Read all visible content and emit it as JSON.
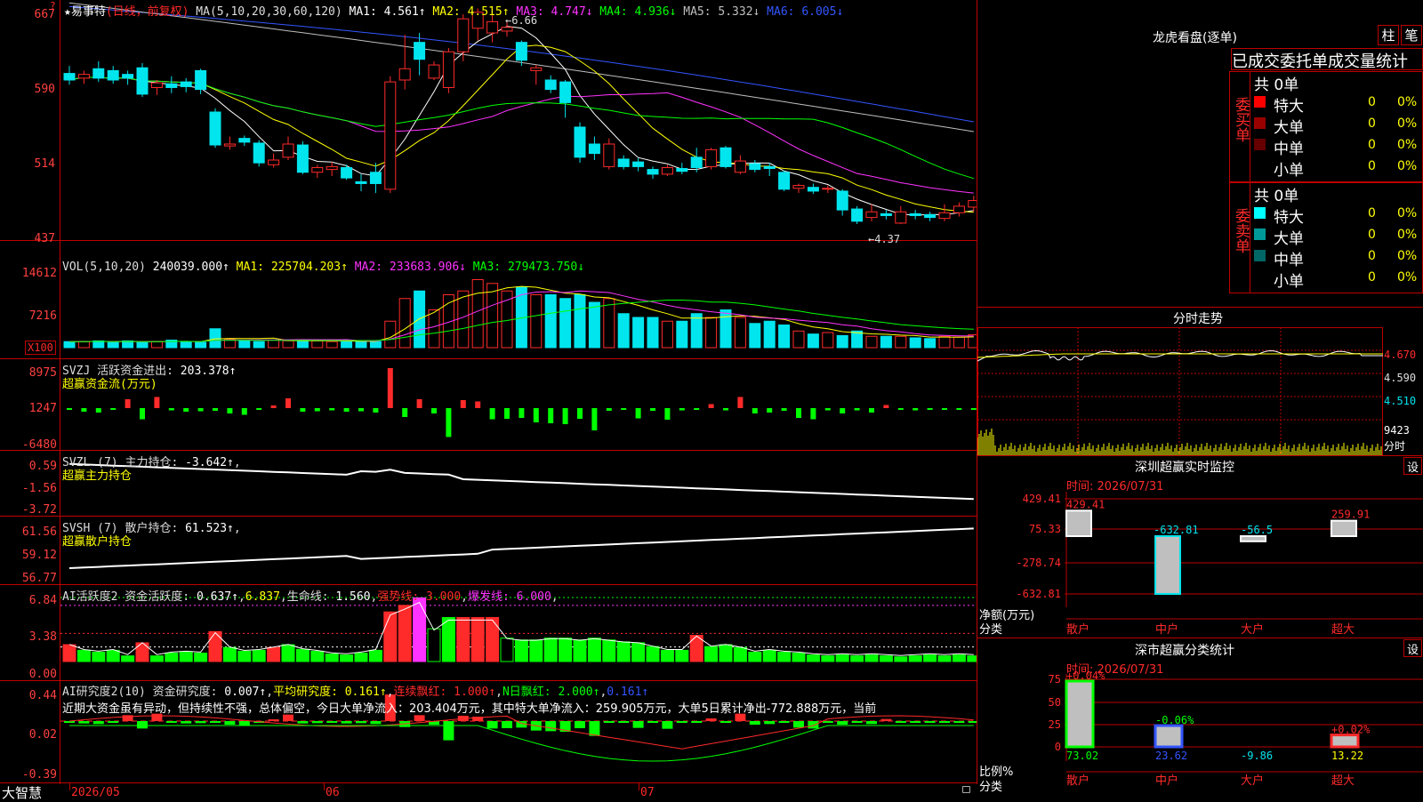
{
  "colors": {
    "up": "#ff2a2a",
    "down": "#00e5ee",
    "axis": "#c00000",
    "text": "#dddddd",
    "yellow": "#ffff00",
    "magenta": "#ff33ff",
    "green": "#00ff00",
    "blue": "#3355ff",
    "white": "#ffffff",
    "gray": "#bfbfbf"
  },
  "app": {
    "logo": "大智慧",
    "question_icon": "question-icon",
    "lock_icon": "lock-icon"
  },
  "main_chart": {
    "title_parts": [
      {
        "text": "★易事特",
        "color": "#ffffff"
      },
      {
        "text": "(日线，前复权)",
        "color": "#ff2a2a"
      },
      {
        "text": " MA(5,10,20,30,60,120) ",
        "color": "#dddddd"
      },
      {
        "text": "MA1: ",
        "color": "#ffffff"
      },
      {
        "text": "4.561↑",
        "color": "#ffffff"
      },
      {
        "text": " MA2: ",
        "color": "#ffff00"
      },
      {
        "text": "4.515↑",
        "color": "#ffff00"
      },
      {
        "text": " MA3: ",
        "color": "#ff33ff"
      },
      {
        "text": "4.747↓",
        "color": "#ff33ff"
      },
      {
        "text": " MA4: ",
        "color": "#00ff00"
      },
      {
        "text": "4.936↓",
        "color": "#00ff00"
      },
      {
        "text": " MA5: ",
        "color": "#bfbfbf"
      },
      {
        "text": "5.332↓",
        "color": "#bfbfbf"
      },
      {
        "text": " MA6: ",
        "color": "#3355ff"
      },
      {
        "text": "6.005↓",
        "color": "#3355ff"
      }
    ],
    "y_ticks": [
      "667",
      "590",
      "514",
      "437"
    ],
    "high_label": "6.66",
    "low_label": "4.37"
  },
  "vol_chart": {
    "title_parts": [
      {
        "text": "VOL(5,10,20) ",
        "color": "#dddddd"
      },
      {
        "text": "240039.000↑",
        "color": "#ffffff"
      },
      {
        "text": " MA1: ",
        "color": "#ffff00"
      },
      {
        "text": "225704.203↑",
        "color": "#ffff00"
      },
      {
        "text": " MA2: ",
        "color": "#ff33ff"
      },
      {
        "text": "233683.906↓",
        "color": "#ff33ff"
      },
      {
        "text": " MA3: ",
        "color": "#00ff00"
      },
      {
        "text": "279473.750↓",
        "color": "#00ff00"
      }
    ],
    "y_ticks": [
      "14612",
      "7216"
    ],
    "unit": "X100"
  },
  "svzj": {
    "title_parts": [
      {
        "text": "SVZJ  活跃资金进出: ",
        "color": "#dddddd"
      },
      {
        "text": "203.378↑",
        "color": "#ffffff"
      }
    ],
    "subtitle": "超赢资金流(万元)",
    "y_ticks": [
      "8975",
      "1247",
      "-6480"
    ]
  },
  "svzl": {
    "title_parts": [
      {
        "text": "SVZL (7) 主力持仓: ",
        "color": "#dddddd"
      },
      {
        "text": "-3.642↑",
        "color": "#ffffff"
      },
      {
        "text": ",",
        "color": "#dddddd"
      }
    ],
    "subtitle": "超赢主力持仓",
    "y_ticks": [
      "0.59",
      "-1.56",
      "-3.72"
    ]
  },
  "svsh": {
    "title_parts": [
      {
        "text": "SVSH (7) 散户持仓: ",
        "color": "#dddddd"
      },
      {
        "text": "61.523↑",
        "color": "#ffffff"
      },
      {
        "text": ",",
        "color": "#dddddd"
      }
    ],
    "subtitle": "超赢散户持仓",
    "y_ticks": [
      "61.56",
      "59.12",
      "56.77"
    ]
  },
  "ai_active": {
    "title_parts": [
      {
        "text": "AI活跃度2 资金活跃度: ",
        "color": "#dddddd"
      },
      {
        "text": "0.637↑",
        "color": "#ffffff"
      },
      {
        "text": ",",
        "color": "#dddddd"
      },
      {
        "text": "6.837",
        "color": "#ffff00"
      },
      {
        "text": ",生命线: ",
        "color": "#dddddd"
      },
      {
        "text": "1.560",
        "color": "#ffffff"
      },
      {
        "text": ",",
        "color": "#dddddd"
      },
      {
        "text": "强势线: 3.000",
        "color": "#ff2a2a"
      },
      {
        "text": ",",
        "color": "#dddddd"
      },
      {
        "text": "爆发线: 6.000",
        "color": "#ff33ff"
      },
      {
        "text": ",",
        "color": "#dddddd"
      }
    ],
    "y_ticks": [
      "6.84",
      "3.38",
      "0.00"
    ]
  },
  "ai_research": {
    "title_parts": [
      {
        "text": "AI研究度2(10) 资金研究度: ",
        "color": "#dddddd"
      },
      {
        "text": "0.007↑",
        "color": "#ffffff"
      },
      {
        "text": ",",
        "color": "#dddddd"
      },
      {
        "text": "平均研究度: 0.161↑",
        "color": "#ffff00"
      },
      {
        "text": ",",
        "color": "#dddddd"
      },
      {
        "text": "连续飘红: 1.000↑",
        "color": "#ff2a2a"
      },
      {
        "text": ",",
        "color": "#dddddd"
      },
      {
        "text": "N日飘红: 2.000↑",
        "color": "#00ff00"
      },
      {
        "text": ",",
        "color": "#dddddd"
      },
      {
        "text": "0.161↑",
        "color": "#3355ff"
      }
    ],
    "comment": "近期大资金虽有异动，但持续性不强，总体偏空，今日大单净流入：203.404万元，其中特大单净流入：259.905万元，大单5日累计净出-772.888万元，当前",
    "y_ticks": [
      "0.44",
      "0.02",
      "-0.39"
    ]
  },
  "x_axis": {
    "labels": [
      "2026/05",
      "06",
      "07"
    ]
  },
  "dragon_panel": {
    "title": "龙虎看盘(逐单)",
    "btn1": "柱",
    "btn2": "笔",
    "tabs": [
      "已成交",
      "委托单",
      "成交量",
      "统计"
    ],
    "buy": {
      "label": "委买单",
      "total": "共 0单",
      "rows": [
        {
          "name": "特大",
          "value": "0",
          "pct": "0%",
          "color": "#ff0000"
        },
        {
          "name": "大单",
          "value": "0",
          "pct": "0%",
          "color": "#990000"
        },
        {
          "name": "中单",
          "value": "0",
          "pct": "0%",
          "color": "#660000"
        },
        {
          "name": "小单",
          "value": "0",
          "pct": "0%",
          "color": "#000000"
        }
      ]
    },
    "sell": {
      "label": "委卖单",
      "total": "共 0单",
      "rows": [
        {
          "name": "特大",
          "value": "0",
          "pct": "0%",
          "color": "#00ffff"
        },
        {
          "name": "大单",
          "value": "0",
          "pct": "0%",
          "color": "#009999"
        },
        {
          "name": "中单",
          "value": "0",
          "pct": "0%",
          "color": "#006666"
        },
        {
          "name": "小单",
          "value": "0",
          "pct": "0%",
          "color": "#000000"
        }
      ]
    }
  },
  "intraday": {
    "title": "分时走势",
    "y_ticks": [
      "4.670",
      "4.590",
      "4.510"
    ],
    "vol_label": "9423",
    "vol_unit": "分时"
  },
  "sz_monitor": {
    "title": "深圳超赢实时监控",
    "settings": "设",
    "time_label": "时间: 2026/07/31",
    "y_ticks": [
      "429.41",
      "75.33",
      "-278.74",
      "-632.81"
    ],
    "unit_label": "净额(万元)",
    "cat_label": "分类",
    "categories": [
      "散户",
      "中户",
      "大户",
      "超大"
    ],
    "value_labels": [
      "429.41",
      "-632.81",
      "-56.5",
      "259.91"
    ]
  },
  "sz_class": {
    "title": "深市超赢分类统计",
    "settings": "设",
    "time_label": "时间: 2026/07/31",
    "y_ticks": [
      "75",
      "50",
      "25",
      "0"
    ],
    "unit_label": "比例%",
    "cat_label": "分类",
    "categories": [
      "散户",
      "中户",
      "大户",
      "超大"
    ],
    "top_labels": [
      "+0.04%",
      "-0.06%",
      "",
      "+0.02%"
    ],
    "bottom_labels": [
      "73.02",
      "23.62",
      "-9.86",
      "13.22"
    ]
  },
  "chart_data": [
    {
      "type": "candlestick",
      "title": "易事特 日线 前复权",
      "ylim": [
        4.2,
        6.75
      ],
      "candles": [
        [
          5.97,
          5.9,
          6.05,
          5.85
        ],
        [
          5.92,
          5.96,
          6.0,
          5.86
        ],
        [
          6.02,
          5.92,
          6.1,
          5.88
        ],
        [
          6.0,
          5.9,
          6.05,
          5.86
        ],
        [
          5.96,
          5.92,
          6.0,
          5.85
        ],
        [
          6.03,
          5.75,
          6.08,
          5.72
        ],
        [
          5.82,
          5.87,
          5.9,
          5.74
        ],
        [
          5.86,
          5.82,
          5.94,
          5.76
        ],
        [
          5.88,
          5.83,
          5.92,
          5.77
        ],
        [
          6.0,
          5.8,
          6.02,
          5.75
        ],
        [
          5.56,
          5.21,
          5.6,
          5.18
        ],
        [
          5.2,
          5.22,
          5.3,
          5.16
        ],
        [
          5.28,
          5.24,
          5.31,
          5.2
        ],
        [
          5.23,
          5.02,
          5.26,
          4.98
        ],
        [
          5.0,
          5.05,
          5.12,
          4.97
        ],
        [
          5.08,
          5.22,
          5.3,
          5.05
        ],
        [
          5.21,
          4.92,
          5.25,
          4.9
        ],
        [
          4.92,
          4.97,
          5.0,
          4.86
        ],
        [
          4.95,
          4.98,
          5.03,
          4.88
        ],
        [
          4.97,
          4.86,
          5.0,
          4.84
        ],
        [
          4.82,
          4.8,
          4.9,
          4.72
        ],
        [
          4.92,
          4.8,
          5.02,
          4.7
        ],
        [
          4.74,
          5.88,
          5.94,
          4.7
        ],
        [
          5.9,
          6.02,
          6.38,
          5.8
        ],
        [
          6.3,
          6.12,
          6.4,
          5.95
        ],
        [
          5.92,
          6.06,
          6.1,
          5.9
        ],
        [
          5.82,
          6.2,
          6.24,
          5.76
        ],
        [
          6.2,
          6.55,
          6.6,
          6.1
        ],
        [
          6.45,
          6.62,
          6.66,
          6.32
        ],
        [
          6.4,
          6.52,
          6.6,
          6.3
        ],
        [
          6.42,
          6.46,
          6.52,
          6.36
        ],
        [
          6.3,
          6.11,
          6.32,
          6.05
        ],
        [
          6.0,
          6.03,
          6.06,
          5.85
        ],
        [
          5.9,
          5.8,
          5.95,
          5.76
        ],
        [
          5.88,
          5.66,
          5.9,
          5.5
        ],
        [
          5.4,
          5.08,
          5.45,
          5.02
        ],
        [
          5.22,
          5.12,
          5.3,
          5.05
        ],
        [
          4.98,
          5.22,
          5.28,
          4.95
        ],
        [
          5.06,
          4.98,
          5.1,
          4.95
        ],
        [
          5.03,
          4.98,
          5.07,
          4.93
        ],
        [
          4.95,
          4.9,
          4.98,
          4.85
        ],
        [
          4.9,
          4.97,
          5.0,
          4.88
        ],
        [
          4.96,
          4.93,
          5.02,
          4.9
        ],
        [
          5.08,
          4.97,
          5.18,
          4.92
        ],
        [
          4.98,
          5.16,
          5.18,
          4.95
        ],
        [
          5.18,
          4.98,
          5.2,
          4.96
        ],
        [
          4.92,
          5.04,
          5.1,
          4.9
        ],
        [
          5.01,
          4.95,
          5.05,
          4.92
        ],
        [
          4.98,
          4.96,
          5.02,
          4.88
        ],
        [
          4.92,
          4.74,
          4.94,
          4.72
        ],
        [
          4.75,
          4.78,
          4.8,
          4.7
        ],
        [
          4.76,
          4.72,
          4.8,
          4.69
        ],
        [
          4.74,
          4.75,
          4.78,
          4.7
        ],
        [
          4.72,
          4.52,
          4.74,
          4.46
        ],
        [
          4.53,
          4.4,
          4.56,
          4.37
        ],
        [
          4.44,
          4.5,
          4.58,
          4.4
        ],
        [
          4.48,
          4.46,
          4.52,
          4.42
        ],
        [
          4.38,
          4.5,
          4.56,
          4.37
        ],
        [
          4.48,
          4.46,
          4.52,
          4.42
        ],
        [
          4.47,
          4.44,
          4.5,
          4.4
        ],
        [
          4.43,
          4.49,
          4.58,
          4.4
        ],
        [
          4.49,
          4.56,
          4.6,
          4.45
        ],
        [
          4.55,
          4.62,
          4.67,
          4.5
        ]
      ]
    },
    {
      "type": "bar",
      "title": "VOL",
      "values": [
        8,
        8,
        9,
        7,
        9,
        7,
        8,
        10,
        8,
        7,
        25,
        11,
        9,
        8,
        10,
        9,
        10,
        9,
        8,
        8,
        8,
        8,
        35,
        65,
        75,
        50,
        70,
        75,
        90,
        85,
        75,
        80,
        70,
        70,
        65,
        70,
        60,
        65,
        45,
        40,
        40,
        35,
        35,
        45,
        40,
        50,
        40,
        32,
        35,
        30,
        22,
        18,
        20,
        16,
        22,
        15,
        15,
        15,
        13,
        12,
        15,
        14,
        17
      ]
    },
    {
      "type": "bar",
      "title": "超赢资金流(万元)",
      "values": [
        -200,
        -800,
        -1000,
        -400,
        2000,
        -2500,
        2500,
        -500,
        -800,
        -700,
        -600,
        -1200,
        -1500,
        -400,
        600,
        2200,
        -800,
        -700,
        -500,
        -800,
        -700,
        -1000,
        8975,
        -2000,
        2000,
        -1200,
        -6480,
        1800,
        1500,
        -2500,
        -2400,
        -2200,
        -3200,
        -3400,
        -3600,
        -2400,
        -5000,
        -600,
        -200,
        -2300,
        -600,
        -2600,
        -500,
        -400,
        900,
        -500,
        2500,
        -1200,
        -1000,
        -600,
        -2200,
        -2500,
        -500,
        -1200,
        -500,
        -1000,
        700,
        -300,
        -500,
        -400,
        -300,
        -300,
        -200
      ]
    },
    {
      "type": "bar",
      "title": "AI活跃度2",
      "values": [
        1.8,
        1.2,
        1.0,
        1.2,
        0.6,
        2.0,
        0.6,
        0.9,
        1.0,
        0.9,
        3.2,
        1.5,
        1.1,
        1.2,
        1.5,
        1.8,
        1.3,
        1.1,
        0.8,
        0.7,
        0.9,
        1.2,
        5.3,
        6.0,
        6.8,
        3.5,
        4.7,
        4.7,
        4.7,
        4.7,
        2.5,
        2.3,
        2.3,
        2.5,
        2.5,
        2.3,
        2.5,
        2.3,
        2.1,
        2.0,
        1.6,
        1.2,
        1.2,
        2.8,
        1.6,
        1.8,
        1.5,
        1.0,
        1.2,
        1.0,
        0.9,
        0.7,
        0.6,
        0.7,
        0.6,
        0.7,
        0.6,
        0.5,
        0.6,
        0.7,
        0.6,
        0.7,
        0.6
      ]
    }
  ]
}
